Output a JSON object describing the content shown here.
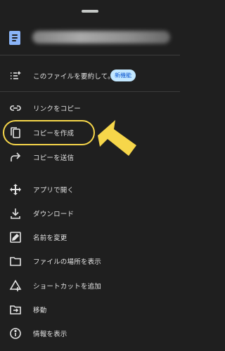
{
  "header": {
    "title_blurred": true
  },
  "summarize": {
    "label": "このファイルを要約して。",
    "badge": "新機能"
  },
  "menu": [
    {
      "id": "copy-link",
      "label": "リンクをコピー",
      "icon": "link-icon"
    },
    {
      "id": "make-copy",
      "label": "コピーを作成",
      "icon": "copy-icon"
    },
    {
      "id": "send-copy",
      "label": "コピーを送信",
      "icon": "forward-icon"
    },
    {
      "id": "open-app",
      "label": "アプリで開く",
      "icon": "open-with-icon"
    },
    {
      "id": "download",
      "label": "ダウンロード",
      "icon": "download-icon"
    },
    {
      "id": "rename",
      "label": "名前を変更",
      "icon": "rename-icon"
    },
    {
      "id": "show-location",
      "label": "ファイルの場所を表示",
      "icon": "folder-icon"
    },
    {
      "id": "add-shortcut",
      "label": "ショートカットを追加",
      "icon": "add-shortcut-icon"
    },
    {
      "id": "move",
      "label": "移動",
      "icon": "move-icon"
    },
    {
      "id": "details",
      "label": "情報を表示",
      "icon": "info-icon"
    }
  ],
  "colors": {
    "background": "#1f1f1f",
    "text": "#e3e3e3",
    "highlight": "#f6d64a",
    "badge_bg": "#c2e7ff",
    "badge_text": "#0b57d0"
  }
}
